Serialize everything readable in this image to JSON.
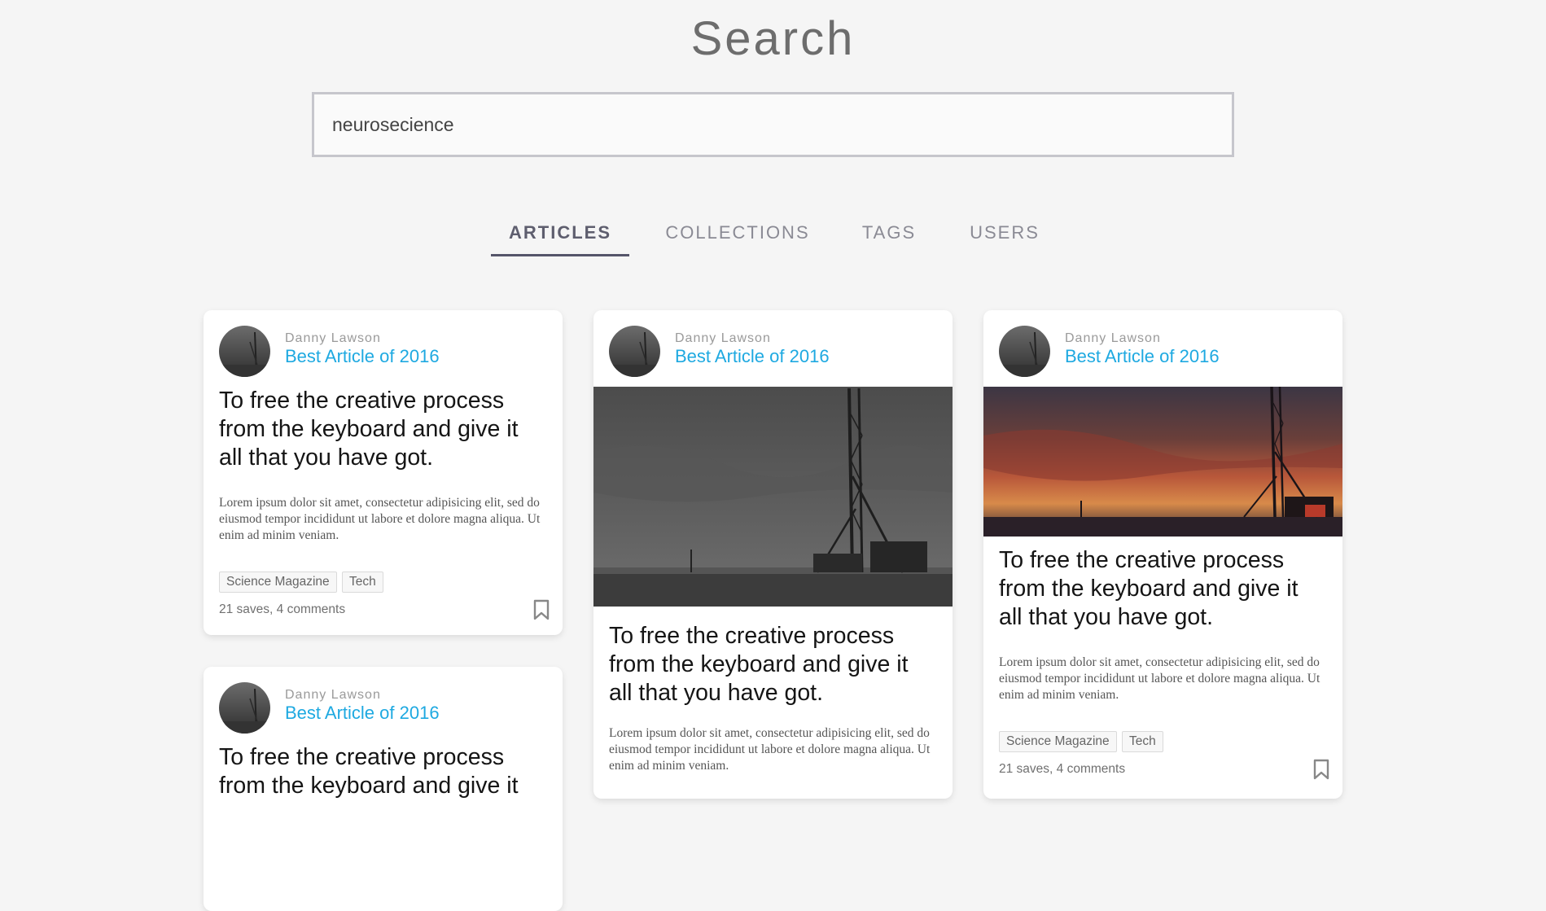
{
  "page": {
    "title": "Search"
  },
  "search": {
    "value": "neurosecience"
  },
  "tabs": [
    {
      "label": "ARTICLES",
      "active": true
    },
    {
      "label": "COLLECTIONS",
      "active": false
    },
    {
      "label": "TAGS",
      "active": false
    },
    {
      "label": "USERS",
      "active": false
    }
  ],
  "cards": [
    {
      "author": "Danny Lawson",
      "collection": "Best Article of 2016",
      "headline": "To free the creative process from the keyboard and give it all that you have got.",
      "excerpt": "Lorem ipsum dolor sit amet, consectetur adipisicing elit, sed do eiusmod tempor incididunt ut labore et dolore magna aliqua. Ut enim ad minim veniam.",
      "tags": [
        "Science Magazine",
        "Tech"
      ],
      "stats": "21 saves, 4 comments"
    },
    {
      "author": "Danny Lawson",
      "collection": "Best Article of 2016",
      "headline": "To free the creative process from the keyboard and give it all that you have got.",
      "excerpt": "Lorem ipsum dolor sit amet, consectetur adipisicing elit, sed do eiusmod tempor incididunt ut labore et dolore magna aliqua. Ut enim ad minim veniam.",
      "image": "grayscale-construction-rig"
    },
    {
      "author": "Danny Lawson",
      "collection": "Best Article of 2016",
      "headline": "To free the creative process from the keyboard and give it all that you have got.",
      "excerpt": "Lorem ipsum dolor sit amet, consectetur adipisicing elit, sed do eiusmod tempor incididunt ut labore et dolore magna aliqua. Ut enim ad minim veniam.",
      "tags": [
        "Science Magazine",
        "Tech"
      ],
      "stats": "21 saves, 4 comments",
      "image": "sunset-construction-rig"
    },
    {
      "author": "Danny Lawson",
      "collection": "Best Article of 2016",
      "headline": "To free the creative process from the keyboard and give it"
    }
  ],
  "colors": {
    "accent": "#1ea9e1",
    "background": "#f5f5f5",
    "tab_active": "#55556a"
  },
  "icons": [
    "bookmark-icon"
  ]
}
